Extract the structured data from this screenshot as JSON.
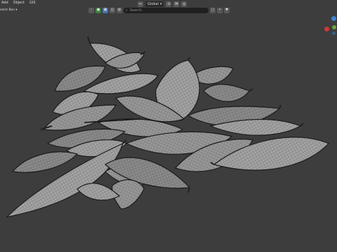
{
  "menu": {
    "items": [
      "Add",
      "Object",
      "GIS"
    ]
  },
  "select_box": {
    "label": "elect Box ▾"
  },
  "header": {
    "view_label": "Global",
    "search_placeholder": "Search",
    "view_icon": "▾",
    "snap_icon": "⌘",
    "filter_icon": "▼"
  },
  "colors": {
    "background": "#3d3d3d",
    "mesh_fill": "#8f8f8f",
    "mesh_edge": "#1c1c1c",
    "accent": "#4772b3",
    "axis_x": "#c93b3b",
    "axis_y": "#6ea53a",
    "axis_z": "#3f84d1"
  },
  "scene": {
    "object": "leaf pile wireframe",
    "leaf_count": 22
  }
}
